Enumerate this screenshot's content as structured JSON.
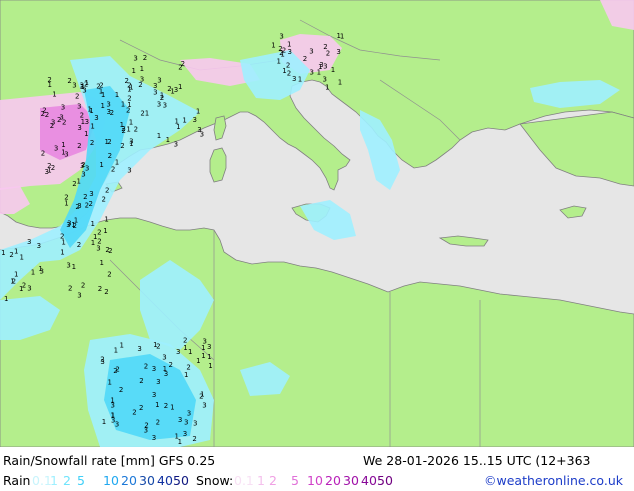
{
  "map": {
    "colors": {
      "sea": "#e6e6e6",
      "land": "#b4ee8c",
      "border": "#808080",
      "rain_light": "#9ff0ff",
      "rain_mid": "#50d8f8",
      "snow_light": "#f8c8f0",
      "snow_mid": "#e888e0"
    },
    "cell_labels": [
      "1",
      "2",
      "3"
    ]
  },
  "legend": {
    "title": "Rain/Snowfall rate [mm] GFS 0.25",
    "datetime": "We 28-01-2026 15..15 UTC (12+363",
    "rain_label": "Rain",
    "rain_ticks": [
      {
        "text": "0.1",
        "color": "#c8f4fc"
      },
      {
        "text": "1",
        "color": "#9ff0ff"
      },
      {
        "text": "2",
        "color": "#70e4fc"
      },
      {
        "text": "5",
        "color": "#40d0f8"
      },
      {
        "text": "10",
        "color": "#20a8f0"
      },
      {
        "text": "20",
        "color": "#1c78d8"
      },
      {
        "text": "30",
        "color": "#1448a8"
      },
      {
        "text": "40",
        "color": "#1030a0"
      },
      {
        "text": "50",
        "color": "#101880"
      }
    ],
    "snow_label": "Snow:",
    "snow_ticks": [
      {
        "text": "0.1",
        "color": "#f8e0f4"
      },
      {
        "text": "1",
        "color": "#f4c0ec"
      },
      {
        "text": "2",
        "color": "#f0a0e4"
      },
      {
        "text": "5",
        "color": "#e070d8"
      },
      {
        "text": "10",
        "color": "#d040c8"
      },
      {
        "text": "20",
        "color": "#b820b8"
      },
      {
        "text": "30",
        "color": "#a010a8"
      },
      {
        "text": "40",
        "color": "#880898"
      },
      {
        "text": "50",
        "color": "#700080"
      }
    ],
    "credit": "©weatheronline.co.uk",
    "credit_color": "#1c3cc8"
  }
}
